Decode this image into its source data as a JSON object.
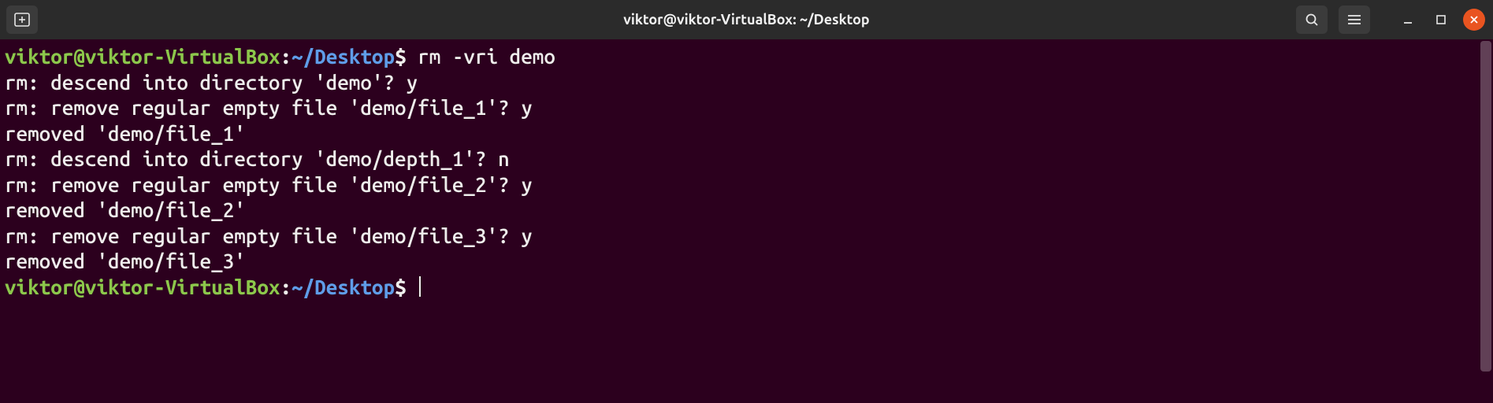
{
  "titlebar": {
    "title": "viktor@viktor-VirtualBox: ~/Desktop"
  },
  "prompt": {
    "user_host": "viktor@viktor-VirtualBox",
    "colon": ":",
    "path": "~/Desktop",
    "dollar": "$"
  },
  "session": {
    "command1": " rm -vri demo",
    "lines": [
      "rm: descend into directory 'demo'? y",
      "rm: remove regular empty file 'demo/file_1'? y",
      "removed 'demo/file_1'",
      "rm: descend into directory 'demo/depth_1'? n",
      "rm: remove regular empty file 'demo/file_2'? y",
      "removed 'demo/file_2'",
      "rm: remove regular empty file 'demo/file_3'? y",
      "removed 'demo/file_3'"
    ],
    "command2": " "
  }
}
